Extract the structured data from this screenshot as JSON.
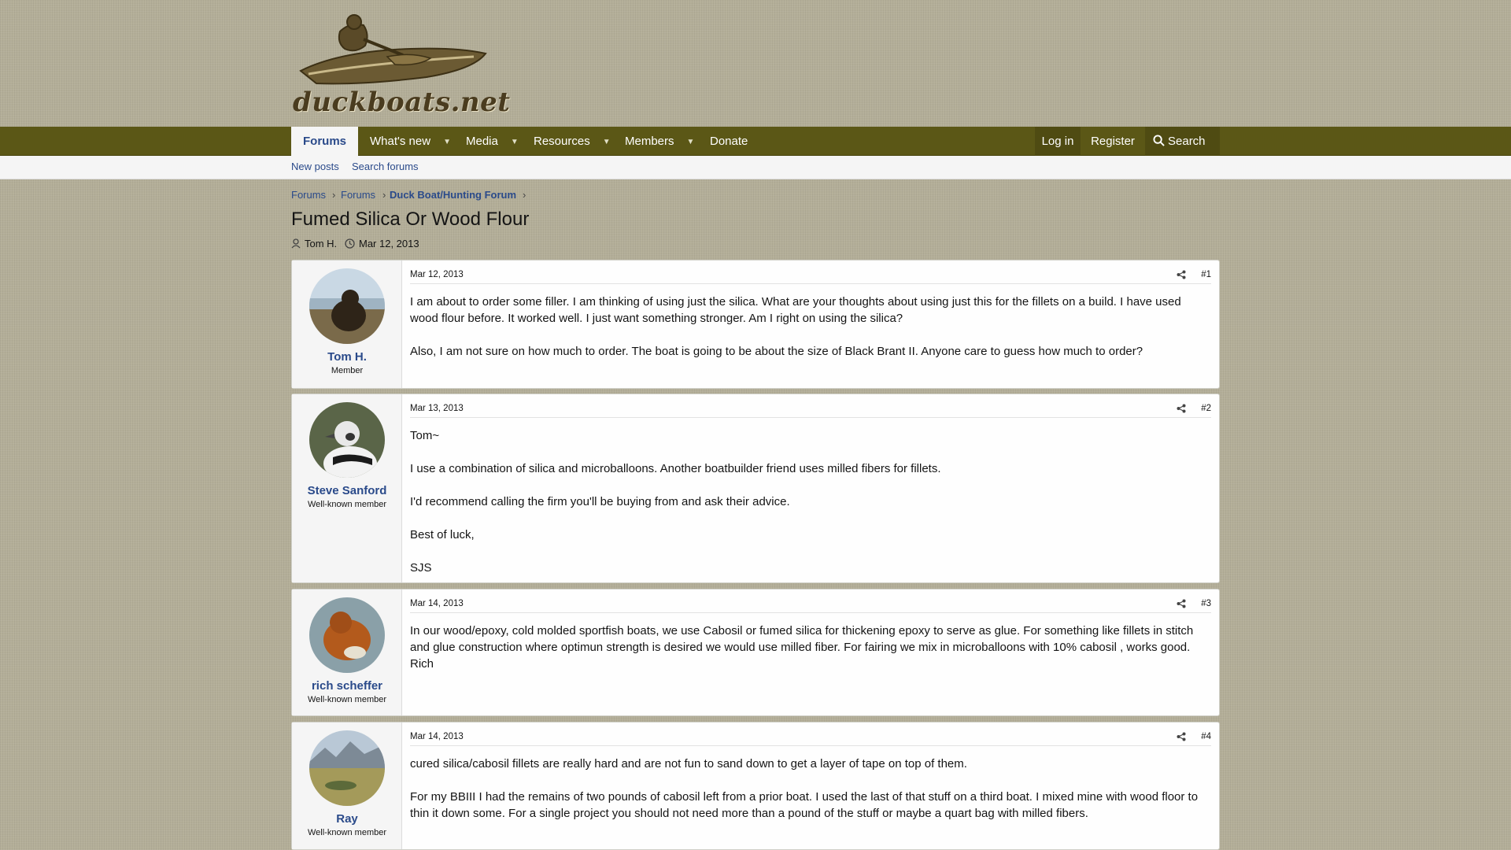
{
  "site": {
    "logo_text": "duckboats.net"
  },
  "nav": {
    "tabs": [
      "Forums",
      "What's new",
      "Media",
      "Resources",
      "Members",
      "Donate"
    ],
    "login": "Log in",
    "register": "Register",
    "search": "Search"
  },
  "subnav": {
    "new_posts": "New posts",
    "search_forums": "Search forums"
  },
  "breadcrumb": [
    "Forums",
    "Forums",
    "Duck Boat/Hunting Forum"
  ],
  "thread": {
    "title": "Fumed Silica Or Wood Flour",
    "author": "Tom H.",
    "date": "Mar 12, 2013"
  },
  "posts": [
    {
      "user": "Tom H.",
      "user_title": "Member",
      "date": "Mar 12, 2013",
      "num": "#1",
      "body": [
        "I am about to order some filler. I am thinking of using just the silica. What are your thoughts about using just this for the fillets on a build. I have used wood flour before. It worked well. I just want something stronger. Am I right on using the silica?",
        "Also, I am not sure on how much to order. The boat is going to be about the size of Black Brant II. Anyone care to guess how much to order?"
      ]
    },
    {
      "user": "Steve Sanford",
      "user_title": "Well-known member",
      "date": "Mar 13, 2013",
      "num": "#2",
      "body": [
        "Tom~",
        "I use a combination of silica and microballoons. Another boatbuilder friend uses milled fibers for fillets.",
        "I'd recommend calling the firm you'll be buying from and ask their advice.",
        "Best of luck,",
        "SJS"
      ]
    },
    {
      "user": "rich scheffer",
      "user_title": "Well-known member",
      "date": "Mar 14, 2013",
      "num": "#3",
      "body": [
        "In our wood/epoxy, cold molded sportfish boats, we use Cabosil or fumed silica for thickening epoxy to serve as glue. For something like fillets in stitch and glue construction where optimun strength is desired we would use milled fiber. For fairing we mix in microballoons with 10% cabosil , works good.",
        "Rich"
      ]
    },
    {
      "user": "Ray",
      "user_title": "Well-known member",
      "date": "Mar 14, 2013",
      "num": "#4",
      "body": [
        "cured silica/cabosil fillets are really hard and are not fun to sand down to get a layer of tape on top of them.",
        "For my BBIII I had the remains of two pounds of cabosil left from a prior boat. I used the last of that stuff on a third boat. I mixed mine with wood floor to thin it down some. For a single project you should not need more than a pound of the stuff or maybe a quart bag with milled fibers."
      ]
    }
  ]
}
